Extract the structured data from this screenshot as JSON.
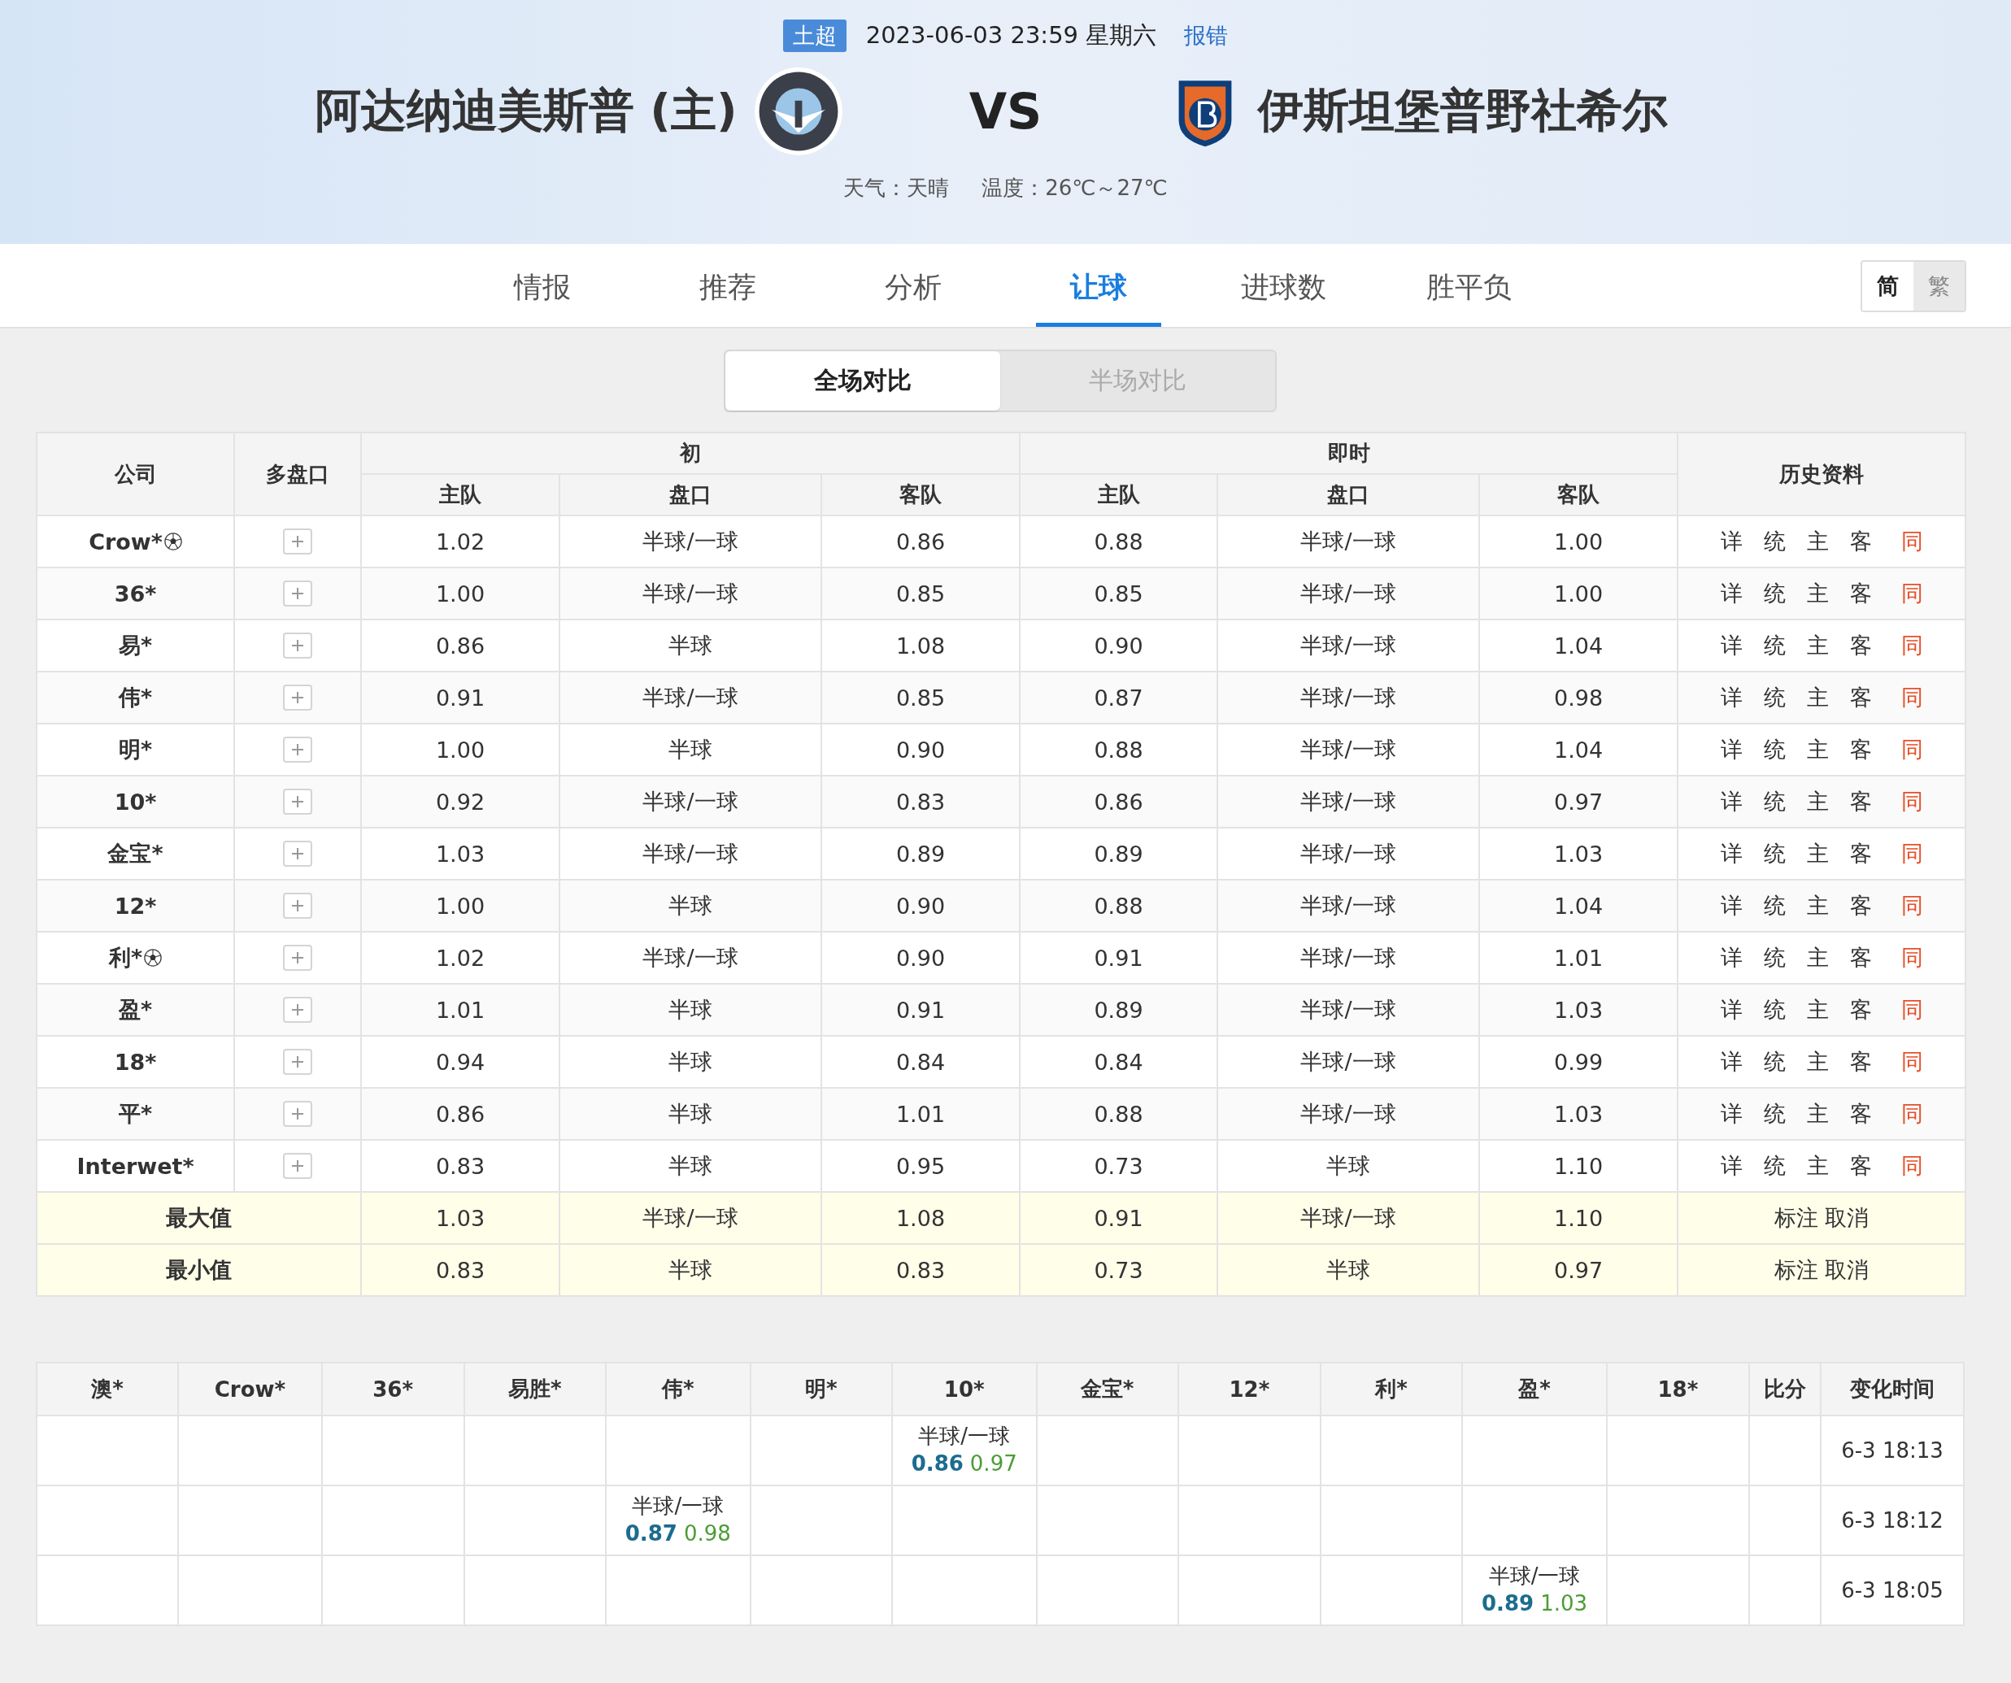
{
  "match": {
    "league": "土超",
    "datetime": "2023-06-03 23:59 星期六",
    "report_link": "报错",
    "home_team": "阿达纳迪美斯普 (主)",
    "vs": "VS",
    "away_team": "伊斯坦堡普野社希尔",
    "weather": "天气：天晴",
    "temperature": "温度：26℃～27℃"
  },
  "tabs": [
    {
      "label": "情报",
      "selected": false
    },
    {
      "label": "推荐",
      "selected": false
    },
    {
      "label": "分析",
      "selected": false
    },
    {
      "label": "让球",
      "selected": true
    },
    {
      "label": "进球数",
      "selected": false
    },
    {
      "label": "胜平负",
      "selected": false
    }
  ],
  "script_toggle": [
    {
      "label": "简",
      "selected": true
    },
    {
      "label": "繁",
      "selected": false
    }
  ],
  "scope_toggle": [
    {
      "label": "全场对比",
      "selected": true
    },
    {
      "label": "半场对比",
      "selected": false
    }
  ],
  "odds_table": {
    "columns": {
      "company": "公司",
      "multi": "多盘口",
      "initial": "初",
      "live": "即时",
      "history": "历史资料"
    },
    "sub_columns": [
      "主队",
      "盘口",
      "客队",
      "主队",
      "盘口",
      "客队"
    ],
    "rows": [
      {
        "company": "Crow*",
        "ball": true,
        "initial": [
          "1.02",
          "半球/一球",
          "0.86"
        ],
        "live": [
          "0.88",
          "半球/一球",
          "1.00"
        ],
        "history": [
          {
            "label": "详",
            "accent": false
          },
          {
            "label": "统",
            "accent": false
          },
          {
            "label": "主",
            "accent": false
          },
          {
            "label": "客",
            "accent": false
          },
          {
            "label": "同",
            "accent": true
          }
        ]
      },
      {
        "company": "36*",
        "ball": false,
        "initial": [
          "1.00",
          "半球/一球",
          "0.85"
        ],
        "live": [
          "0.85",
          "半球/一球",
          "1.00"
        ],
        "history": [
          {
            "label": "详",
            "accent": false
          },
          {
            "label": "统",
            "accent": false
          },
          {
            "label": "主",
            "accent": false
          },
          {
            "label": "客",
            "accent": false
          },
          {
            "label": "同",
            "accent": true
          }
        ]
      },
      {
        "company": "易*",
        "ball": false,
        "initial": [
          "0.86",
          "半球",
          "1.08"
        ],
        "live": [
          "0.90",
          "半球/一球",
          "1.04"
        ],
        "history": [
          {
            "label": "详",
            "accent": false
          },
          {
            "label": "统",
            "accent": false
          },
          {
            "label": "主",
            "accent": false
          },
          {
            "label": "客",
            "accent": false
          },
          {
            "label": "同",
            "accent": true
          }
        ]
      },
      {
        "company": "伟*",
        "ball": false,
        "initial": [
          "0.91",
          "半球/一球",
          "0.85"
        ],
        "live": [
          "0.87",
          "半球/一球",
          "0.98"
        ],
        "history": [
          {
            "label": "详",
            "accent": false
          },
          {
            "label": "统",
            "accent": false
          },
          {
            "label": "主",
            "accent": false
          },
          {
            "label": "客",
            "accent": false
          },
          {
            "label": "同",
            "accent": true
          }
        ]
      },
      {
        "company": "明*",
        "ball": false,
        "initial": [
          "1.00",
          "半球",
          "0.90"
        ],
        "live": [
          "0.88",
          "半球/一球",
          "1.04"
        ],
        "history": [
          {
            "label": "详",
            "accent": false
          },
          {
            "label": "统",
            "accent": false
          },
          {
            "label": "主",
            "accent": false
          },
          {
            "label": "客",
            "accent": false
          },
          {
            "label": "同",
            "accent": true
          }
        ]
      },
      {
        "company": "10*",
        "ball": false,
        "initial": [
          "0.92",
          "半球/一球",
          "0.83"
        ],
        "live": [
          "0.86",
          "半球/一球",
          "0.97"
        ],
        "history": [
          {
            "label": "详",
            "accent": false
          },
          {
            "label": "统",
            "accent": false
          },
          {
            "label": "主",
            "accent": false
          },
          {
            "label": "客",
            "accent": false
          },
          {
            "label": "同",
            "accent": true
          }
        ]
      },
      {
        "company": "金宝*",
        "ball": false,
        "initial": [
          "1.03",
          "半球/一球",
          "0.89"
        ],
        "live": [
          "0.89",
          "半球/一球",
          "1.03"
        ],
        "history": [
          {
            "label": "详",
            "accent": false
          },
          {
            "label": "统",
            "accent": false
          },
          {
            "label": "主",
            "accent": false
          },
          {
            "label": "客",
            "accent": false
          },
          {
            "label": "同",
            "accent": true
          }
        ]
      },
      {
        "company": "12*",
        "ball": false,
        "initial": [
          "1.00",
          "半球",
          "0.90"
        ],
        "live": [
          "0.88",
          "半球/一球",
          "1.04"
        ],
        "history": [
          {
            "label": "详",
            "accent": false
          },
          {
            "label": "统",
            "accent": false
          },
          {
            "label": "主",
            "accent": false
          },
          {
            "label": "客",
            "accent": false
          },
          {
            "label": "同",
            "accent": true
          }
        ]
      },
      {
        "company": "利*",
        "ball": true,
        "initial": [
          "1.02",
          "半球/一球",
          "0.90"
        ],
        "live": [
          "0.91",
          "半球/一球",
          "1.01"
        ],
        "history": [
          {
            "label": "详",
            "accent": false
          },
          {
            "label": "统",
            "accent": false
          },
          {
            "label": "主",
            "accent": false
          },
          {
            "label": "客",
            "accent": false
          },
          {
            "label": "同",
            "accent": true
          }
        ]
      },
      {
        "company": "盈*",
        "ball": false,
        "initial": [
          "1.01",
          "半球",
          "0.91"
        ],
        "live": [
          "0.89",
          "半球/一球",
          "1.03"
        ],
        "history": [
          {
            "label": "详",
            "accent": false
          },
          {
            "label": "统",
            "accent": false
          },
          {
            "label": "主",
            "accent": false
          },
          {
            "label": "客",
            "accent": false
          },
          {
            "label": "同",
            "accent": true
          }
        ]
      },
      {
        "company": "18*",
        "ball": false,
        "initial": [
          "0.94",
          "半球",
          "0.84"
        ],
        "live": [
          "0.84",
          "半球/一球",
          "0.99"
        ],
        "history": [
          {
            "label": "详",
            "accent": false
          },
          {
            "label": "统",
            "accent": false
          },
          {
            "label": "主",
            "accent": false
          },
          {
            "label": "客",
            "accent": false
          },
          {
            "label": "同",
            "accent": true
          }
        ]
      },
      {
        "company": "平*",
        "ball": false,
        "initial": [
          "0.86",
          "半球",
          "1.01"
        ],
        "live": [
          "0.88",
          "半球/一球",
          "1.03"
        ],
        "history": [
          {
            "label": "详",
            "accent": false
          },
          {
            "label": "统",
            "accent": false
          },
          {
            "label": "主",
            "accent": false
          },
          {
            "label": "客",
            "accent": false
          },
          {
            "label": "同",
            "accent": true
          }
        ]
      },
      {
        "company": "Interwet*",
        "ball": false,
        "initial": [
          "0.83",
          "半球",
          "0.95"
        ],
        "live": [
          "0.73",
          "半球",
          "1.10"
        ],
        "history": [
          {
            "label": "详",
            "accent": false
          },
          {
            "label": "统",
            "accent": false
          },
          {
            "label": "主",
            "accent": false
          },
          {
            "label": "客",
            "accent": false
          },
          {
            "label": "同",
            "accent": true
          }
        ]
      }
    ],
    "summary": [
      {
        "label": "最大值",
        "initial": [
          "1.03",
          "半球/一球",
          "1.08"
        ],
        "live": [
          "0.91",
          "半球/一球",
          "1.10"
        ],
        "actions": [
          "标注",
          "取消"
        ]
      },
      {
        "label": "最小值",
        "initial": [
          "0.83",
          "半球",
          "0.83"
        ],
        "live": [
          "0.73",
          "半球",
          "0.97"
        ],
        "actions": [
          "标注",
          "取消"
        ]
      }
    ]
  },
  "change_table": {
    "columns": [
      "澳*",
      "Crow*",
      "36*",
      "易胜*",
      "伟*",
      "明*",
      "10*",
      "金宝*",
      "12*",
      "利*",
      "盈*",
      "18*",
      "比分",
      "变化时间"
    ],
    "rows": [
      {
        "cells": [
          null,
          null,
          null,
          null,
          null,
          null,
          {
            "line": "半球/一球",
            "home": "0.86",
            "away": "0.97"
          },
          null,
          null,
          null,
          null,
          null,
          null
        ],
        "time": "6-3 18:13"
      },
      {
        "cells": [
          null,
          null,
          null,
          null,
          {
            "line": "半球/一球",
            "home": "0.87",
            "away": "0.98"
          },
          null,
          null,
          null,
          null,
          null,
          null,
          null,
          null
        ],
        "time": "6-3 18:12"
      },
      {
        "cells": [
          null,
          null,
          null,
          null,
          null,
          null,
          null,
          null,
          null,
          null,
          {
            "line": "半球/一球",
            "home": "0.89",
            "away": "1.03"
          },
          null,
          null
        ],
        "time": "6-3 18:05"
      }
    ]
  }
}
